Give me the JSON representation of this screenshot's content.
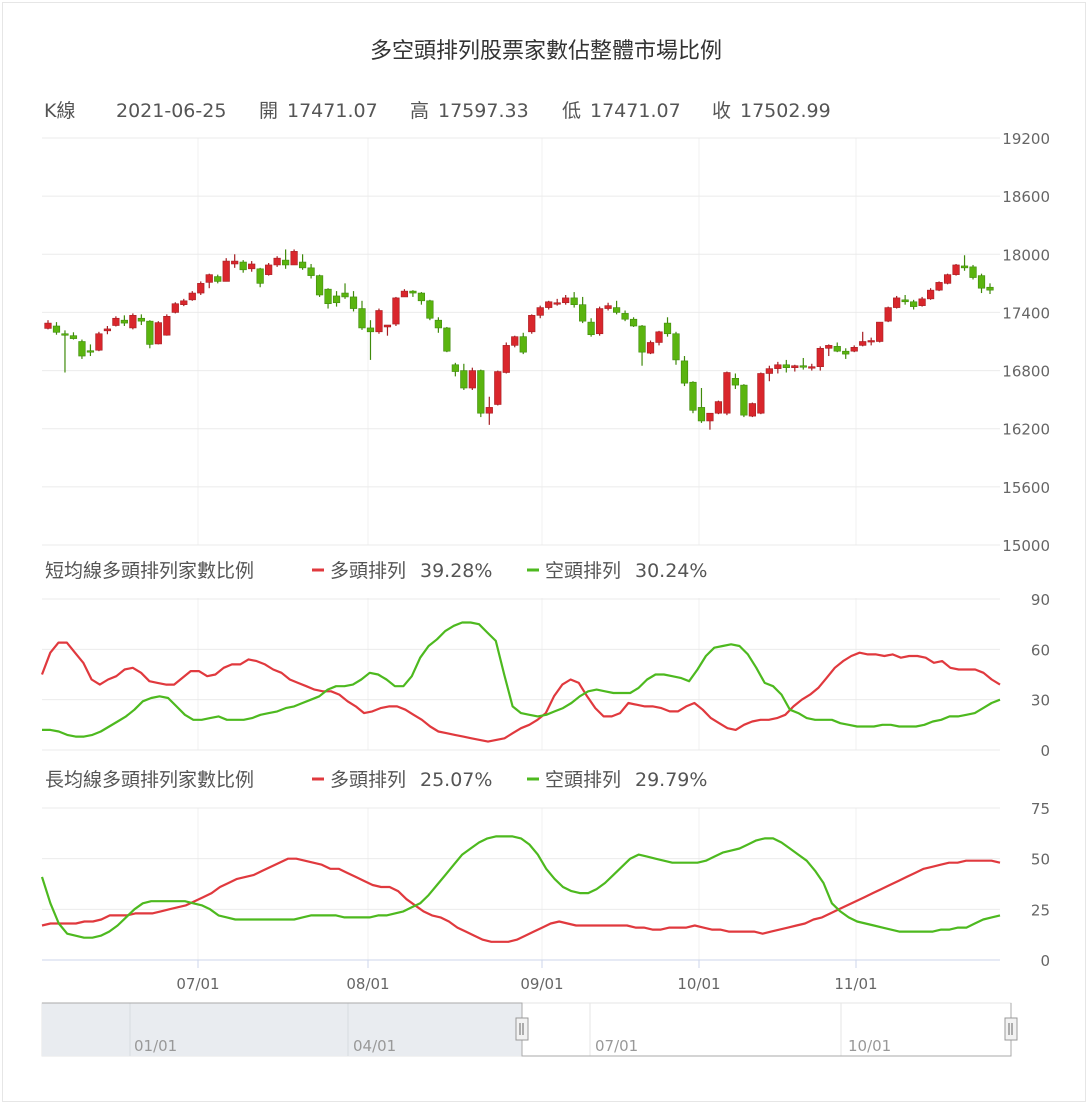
{
  "chart_data": {
    "type": "candlestick+line",
    "title": "多空頭排列股票家數佔整體市場比例",
    "info": {
      "k_label": "K線",
      "date": "2021-06-25",
      "open_label": "開",
      "open": "17471.07",
      "high_label": "高",
      "high": "17597.33",
      "low_label": "低",
      "low": "17471.07",
      "close_label": "收",
      "close": "17502.99"
    },
    "x_tick_labels": [
      "07/01",
      "08/01",
      "09/01",
      "10/01",
      "11/01"
    ],
    "ohlc": {
      "ylim": [
        15000,
        19200
      ],
      "y_ticks": [
        15000,
        15600,
        16200,
        16800,
        17400,
        18000,
        18600,
        19200
      ],
      "candle_count": 112,
      "candles_ohlc": [
        [
          17235,
          17320,
          17225,
          17290
        ],
        [
          17260,
          17300,
          17170,
          17195
        ],
        [
          17180,
          17215,
          16780,
          17175
        ],
        [
          17160,
          17195,
          17120,
          17130
        ],
        [
          17100,
          17120,
          16920,
          16950
        ],
        [
          17005,
          17070,
          16950,
          17000
        ],
        [
          17010,
          17200,
          17000,
          17180
        ],
        [
          17210,
          17260,
          17175,
          17230
        ],
        [
          17265,
          17360,
          17255,
          17340
        ],
        [
          17320,
          17370,
          17260,
          17290
        ],
        [
          17240,
          17390,
          17225,
          17370
        ],
        [
          17340,
          17380,
          17270,
          17310
        ],
        [
          17310,
          17320,
          17030,
          17070
        ],
        [
          17075,
          17310,
          17070,
          17295
        ],
        [
          17165,
          17380,
          17160,
          17360
        ],
        [
          17400,
          17505,
          17390,
          17490
        ],
        [
          17480,
          17540,
          17465,
          17520
        ],
        [
          17530,
          17620,
          17520,
          17600
        ],
        [
          17600,
          17720,
          17580,
          17700
        ],
        [
          17710,
          17800,
          17650,
          17790
        ],
        [
          17770,
          17790,
          17700,
          17720
        ],
        [
          17720,
          17960,
          17720,
          17930
        ],
        [
          17900,
          18000,
          17860,
          17930
        ],
        [
          17920,
          17940,
          17810,
          17840
        ],
        [
          17850,
          17930,
          17820,
          17900
        ],
        [
          17850,
          17860,
          17660,
          17700
        ],
        [
          17790,
          17910,
          17780,
          17890
        ],
        [
          17890,
          17980,
          17870,
          17960
        ],
        [
          17940,
          18050,
          17850,
          17890
        ],
        [
          17890,
          18050,
          17890,
          18030
        ],
        [
          17920,
          18000,
          17840,
          17860
        ],
        [
          17860,
          17900,
          17750,
          17780
        ],
        [
          17780,
          17790,
          17560,
          17580
        ],
        [
          17640,
          17650,
          17440,
          17490
        ],
        [
          17570,
          17620,
          17460,
          17500
        ],
        [
          17600,
          17700,
          17540,
          17560
        ],
        [
          17560,
          17620,
          17410,
          17440
        ],
        [
          17440,
          17520,
          17220,
          17240
        ],
        [
          17240,
          17320,
          16910,
          17200
        ],
        [
          17200,
          17440,
          17180,
          17420
        ],
        [
          17250,
          17260,
          17160,
          17270
        ],
        [
          17280,
          17560,
          17260,
          17550
        ],
        [
          17560,
          17640,
          17560,
          17620
        ],
        [
          17620,
          17630,
          17560,
          17600
        ],
        [
          17600,
          17610,
          17480,
          17520
        ],
        [
          17520,
          17530,
          17320,
          17340
        ],
        [
          17320,
          17350,
          17190,
          17240
        ],
        [
          17240,
          17250,
          16990,
          17000
        ],
        [
          16860,
          16880,
          16740,
          16790
        ],
        [
          16800,
          16870,
          16600,
          16620
        ],
        [
          16620,
          16830,
          16600,
          16800
        ],
        [
          16800,
          16810,
          16320,
          16360
        ],
        [
          16360,
          16530,
          16240,
          16420
        ],
        [
          16450,
          16800,
          16440,
          16790
        ],
        [
          16780,
          17090,
          16770,
          17060
        ],
        [
          17060,
          17160,
          17040,
          17150
        ],
        [
          17150,
          17190,
          16970,
          16990
        ],
        [
          17200,
          17380,
          17180,
          17370
        ],
        [
          17370,
          17470,
          17340,
          17450
        ],
        [
          17450,
          17520,
          17430,
          17510
        ],
        [
          17500,
          17540,
          17470,
          17500
        ],
        [
          17500,
          17580,
          17480,
          17550
        ],
        [
          17550,
          17610,
          17450,
          17480
        ],
        [
          17480,
          17560,
          17290,
          17310
        ],
        [
          17300,
          17340,
          17150,
          17170
        ],
        [
          17180,
          17460,
          17160,
          17440
        ],
        [
          17440,
          17500,
          17420,
          17470
        ],
        [
          17450,
          17520,
          17380,
          17400
        ],
        [
          17390,
          17420,
          17310,
          17330
        ],
        [
          17330,
          17350,
          17250,
          17260
        ],
        [
          17260,
          17270,
          16850,
          16990
        ],
        [
          16980,
          17110,
          16970,
          17090
        ],
        [
          17090,
          17210,
          17060,
          17200
        ],
        [
          17290,
          17350,
          17150,
          17180
        ],
        [
          17180,
          17200,
          16860,
          16910
        ],
        [
          16900,
          16950,
          16640,
          16670
        ],
        [
          16680,
          16690,
          16360,
          16390
        ],
        [
          16420,
          16620,
          16260,
          16280
        ],
        [
          16280,
          16360,
          16190,
          16360
        ],
        [
          16360,
          16490,
          16350,
          16480
        ],
        [
          16360,
          16790,
          16340,
          16780
        ],
        [
          16720,
          16770,
          16610,
          16650
        ],
        [
          16650,
          16660,
          16320,
          16340
        ],
        [
          16330,
          16470,
          16320,
          16460
        ],
        [
          16360,
          16780,
          16350,
          16770
        ],
        [
          16770,
          16850,
          16690,
          16820
        ],
        [
          16820,
          16890,
          16770,
          16860
        ],
        [
          16860,
          16910,
          16780,
          16830
        ],
        [
          16830,
          16860,
          16790,
          16850
        ],
        [
          16850,
          16930,
          16810,
          16840
        ],
        [
          16840,
          16870,
          16800,
          16840
        ],
        [
          16840,
          17050,
          16800,
          17030
        ],
        [
          17030,
          17070,
          16950,
          17060
        ],
        [
          17050,
          17090,
          16990,
          17000
        ],
        [
          17000,
          17030,
          16920,
          16970
        ],
        [
          17000,
          17060,
          16990,
          17040
        ],
        [
          17060,
          17200,
          17050,
          17100
        ],
        [
          17100,
          17140,
          17060,
          17110
        ],
        [
          17100,
          17300,
          17090,
          17300
        ],
        [
          17310,
          17460,
          17300,
          17450
        ],
        [
          17450,
          17570,
          17440,
          17550
        ],
        [
          17530,
          17580,
          17480,
          17510
        ],
        [
          17510,
          17530,
          17430,
          17460
        ],
        [
          17470,
          17560,
          17460,
          17540
        ],
        [
          17540,
          17650,
          17530,
          17630
        ],
        [
          17630,
          17720,
          17620,
          17710
        ],
        [
          17700,
          17800,
          17690,
          17790
        ],
        [
          17790,
          17900,
          17780,
          17890
        ],
        [
          17880,
          17990,
          17830,
          17860
        ],
        [
          17870,
          17890,
          17740,
          17760
        ],
        [
          17780,
          17800,
          17600,
          17650
        ],
        [
          17660,
          17700,
          17590,
          17630
        ]
      ]
    },
    "short_panel": {
      "label": "短均線多頭排列家數比例",
      "ylim": [
        0,
        90
      ],
      "y_ticks": [
        0,
        30,
        60,
        90
      ],
      "series": [
        {
          "name": "多頭排列",
          "value": "39.28%",
          "color": "#e0393e",
          "values": [
            45,
            58,
            64,
            64,
            58,
            52,
            42,
            39,
            42,
            44,
            48,
            49,
            46,
            41,
            40,
            39,
            39,
            43,
            47,
            47,
            44,
            45,
            49,
            51,
            51,
            54,
            53,
            51,
            48,
            46,
            42,
            40,
            38,
            36,
            35,
            35,
            33,
            29,
            26,
            22,
            23,
            25,
            26,
            26,
            24,
            21,
            18,
            14,
            11,
            10,
            9,
            8,
            7,
            6,
            5,
            6,
            7,
            10,
            13,
            15,
            18,
            22,
            32,
            39,
            42,
            40,
            32,
            25,
            20,
            20,
            22,
            28,
            27,
            26,
            26,
            25,
            23,
            23,
            26,
            28,
            24,
            19,
            16,
            13,
            12,
            15,
            17,
            18,
            18,
            19,
            21,
            26,
            30,
            33,
            37,
            43,
            49,
            53,
            56,
            58,
            57,
            57,
            56,
            57,
            55,
            56,
            56,
            55,
            52,
            53,
            49,
            48,
            48,
            48,
            46,
            42,
            39
          ]
        },
        {
          "name": "空頭排列",
          "value": "30.24%",
          "color": "#4db91f",
          "values": [
            12,
            12,
            11,
            9,
            8,
            8,
            9,
            11,
            14,
            17,
            20,
            24,
            29,
            31,
            32,
            31,
            26,
            21,
            18,
            18,
            19,
            20,
            18,
            18,
            18,
            19,
            21,
            22,
            23,
            25,
            26,
            28,
            30,
            32,
            36,
            38,
            38,
            39,
            42,
            46,
            45,
            42,
            38,
            38,
            44,
            55,
            62,
            66,
            71,
            74,
            76,
            76,
            75,
            70,
            65,
            45,
            26,
            22,
            21,
            20,
            21,
            23,
            25,
            28,
            32,
            35,
            36,
            35,
            34,
            34,
            34,
            37,
            42,
            45,
            45,
            44,
            43,
            41,
            48,
            56,
            61,
            62,
            63,
            62,
            57,
            49,
            40,
            38,
            33,
            24,
            22,
            19,
            18,
            18,
            18,
            16,
            15,
            14,
            14,
            14,
            15,
            15,
            14,
            14,
            14,
            15,
            17,
            18,
            20,
            20,
            21,
            22,
            25,
            28,
            30
          ]
        }
      ]
    },
    "long_panel": {
      "label": "長均線多頭排列家數比例",
      "ylim": [
        0,
        75
      ],
      "y_ticks": [
        0,
        25,
        50,
        75
      ],
      "series": [
        {
          "name": "多頭排列",
          "value": "25.07%",
          "color": "#e0393e",
          "values": [
            17,
            18,
            18,
            18,
            18,
            19,
            19,
            20,
            22,
            22,
            22,
            23,
            23,
            23,
            24,
            25,
            26,
            27,
            29,
            31,
            33,
            36,
            38,
            40,
            41,
            42,
            44,
            46,
            48,
            50,
            50,
            49,
            48,
            47,
            45,
            45,
            43,
            41,
            39,
            37,
            36,
            36,
            34,
            30,
            27,
            24,
            22,
            21,
            19,
            16,
            14,
            12,
            10,
            9,
            9,
            9,
            10,
            12,
            14,
            16,
            18,
            19,
            18,
            17,
            17,
            17,
            17,
            17,
            17,
            17,
            16,
            16,
            15,
            15,
            16,
            16,
            16,
            17,
            16,
            15,
            15,
            14,
            14,
            14,
            14,
            13,
            14,
            15,
            16,
            17,
            18,
            20,
            21,
            23,
            25,
            27,
            29,
            31,
            33,
            35,
            37,
            39,
            41,
            43,
            45,
            46,
            47,
            48,
            48,
            49,
            49,
            49,
            49,
            48
          ]
        },
        {
          "name": "空頭排列",
          "value": "29.79%",
          "color": "#4db91f",
          "values": [
            41,
            28,
            18,
            13,
            12,
            11,
            11,
            12,
            14,
            17,
            21,
            25,
            28,
            29,
            29,
            29,
            29,
            29,
            28,
            27,
            25,
            22,
            21,
            20,
            20,
            20,
            20,
            20,
            20,
            20,
            20,
            21,
            22,
            22,
            22,
            22,
            21,
            21,
            21,
            21,
            22,
            22,
            23,
            24,
            26,
            28,
            32,
            37,
            42,
            47,
            52,
            55,
            58,
            60,
            61,
            61,
            61,
            60,
            57,
            52,
            45,
            40,
            36,
            34,
            33,
            33,
            35,
            38,
            42,
            46,
            50,
            52,
            51,
            50,
            49,
            48,
            48,
            48,
            48,
            49,
            51,
            53,
            54,
            55,
            57,
            59,
            60,
            60,
            58,
            55,
            52,
            49,
            44,
            38,
            28,
            24,
            21,
            19,
            18,
            17,
            16,
            15,
            14,
            14,
            14,
            14,
            14,
            15,
            15,
            16,
            16,
            18,
            20,
            21,
            22
          ]
        }
      ]
    },
    "navigator": {
      "tick_labels": [
        "01/01",
        "04/01",
        "07/01",
        "10/01"
      ]
    }
  }
}
